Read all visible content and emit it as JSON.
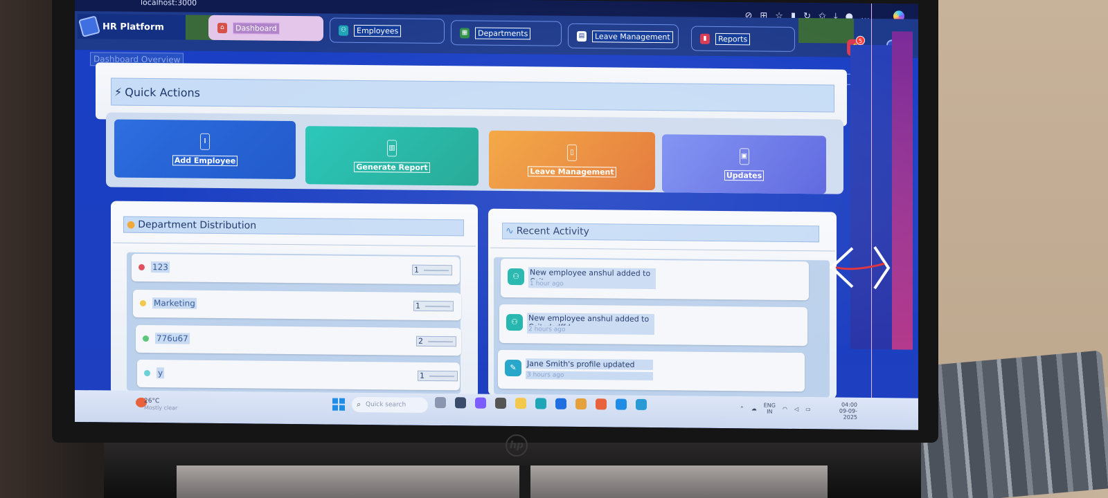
{
  "browser": {
    "url": "localhost:3000",
    "toolbar_icons": [
      "copilot-icon",
      "apps-icon",
      "favorite-star-icon",
      "extension-icon",
      "refresh-icon",
      "collections-icon",
      "downloads-icon",
      "profile-icon",
      "more-icon",
      "edge-icon"
    ]
  },
  "app": {
    "brand": "HR Platform",
    "nav_tabs": [
      {
        "label": "Dashboard",
        "icon": "home-icon",
        "active": true
      },
      {
        "label": "Employees",
        "icon": "users-icon",
        "active": false
      },
      {
        "label": "Departments",
        "icon": "building-icon",
        "active": false
      },
      {
        "label": "Leave Management",
        "icon": "calendar-icon",
        "active": false
      },
      {
        "label": "Reports",
        "icon": "report-icon",
        "active": false
      }
    ],
    "notifications_count": "5"
  },
  "breadcrumb": "Dashboard Overview",
  "quick_actions": {
    "title": "Quick Actions",
    "items": [
      {
        "label": "Add Employee",
        "color_from": "#2f6fe0",
        "color_to": "#1b55c9"
      },
      {
        "label": "Generate Report",
        "color_from": "#26c6b8",
        "color_to": "#17a48f"
      },
      {
        "label": "Leave Management",
        "color_from": "#f3a43a",
        "color_to": "#e2702f"
      },
      {
        "label": "Updates",
        "color_from": "#7a8df2",
        "color_to": "#5a63de"
      }
    ]
  },
  "department_distribution": {
    "title": "Department Distribution",
    "rows": [
      {
        "name": "123",
        "count": "1",
        "dot": "#e05260"
      },
      {
        "name": "Marketing",
        "count": "1",
        "dot": "#f2c94c"
      },
      {
        "name": "776u67",
        "count": "2",
        "dot": "#5cc77a"
      },
      {
        "name": "y",
        "count": "1",
        "dot": "#6ad1d6"
      }
    ]
  },
  "recent_activity": {
    "title": "Recent Activity",
    "items": [
      {
        "text": "New employee anshul added to Csit",
        "time": "1 hour ago",
        "icon": "user-plus-icon"
      },
      {
        "text": "New employee anshul added to Csitsdsdffd",
        "time": "2 hours ago",
        "icon": "user-plus-icon"
      },
      {
        "text": "Jane Smith's profile updated",
        "time": "3 hours ago",
        "icon": "edit-icon"
      }
    ]
  },
  "taskbar": {
    "weather_temp": "26°C",
    "weather_desc": "Mostly clear",
    "search_placeholder": "Quick search",
    "lang": "ENG",
    "region": "IN",
    "time": "04:00",
    "date": "09-09-2025"
  }
}
